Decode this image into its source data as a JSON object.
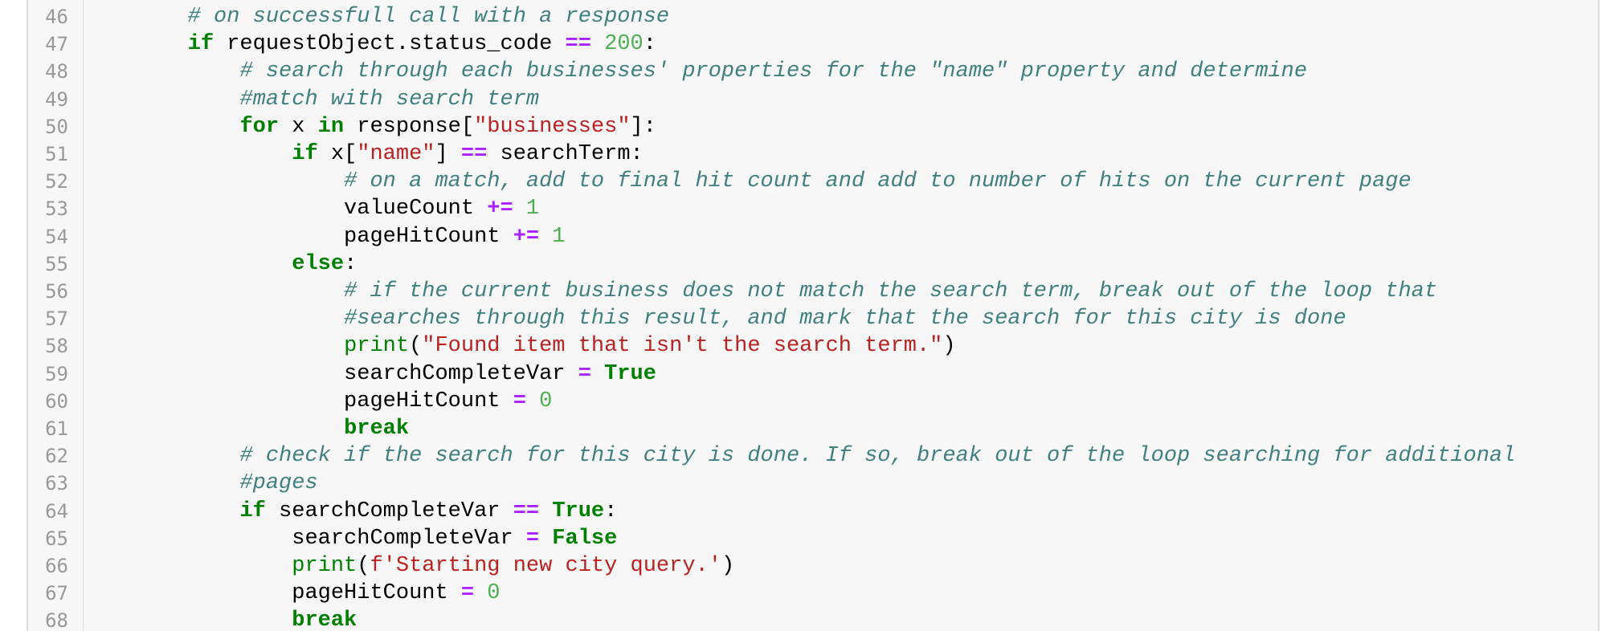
{
  "editor": {
    "colors": {
      "comment": "#408080",
      "keyword": "#008000",
      "operator": "#AA22FF",
      "number": "#4CAF50",
      "string": "#BA2121",
      "builtin": "#008000",
      "line_number": "#999999",
      "background": "#F7F7F7"
    },
    "lines": [
      {
        "n": "46",
        "tokens": [
          {
            "k": "plain",
            "t": "        "
          },
          {
            "k": "comment",
            "t": "# on successfull call with a response"
          }
        ]
      },
      {
        "n": "47",
        "tokens": [
          {
            "k": "plain",
            "t": "        "
          },
          {
            "k": "keyword",
            "t": "if"
          },
          {
            "k": "plain",
            "t": " requestObject.status_code "
          },
          {
            "k": "op",
            "t": "=="
          },
          {
            "k": "plain",
            "t": " "
          },
          {
            "k": "num",
            "t": "200"
          },
          {
            "k": "plain",
            "t": ":"
          }
        ]
      },
      {
        "n": "48",
        "tokens": [
          {
            "k": "plain",
            "t": "            "
          },
          {
            "k": "comment",
            "t": "# search through each businesses' properties for the \"name\" property and determine"
          }
        ]
      },
      {
        "n": "49",
        "tokens": [
          {
            "k": "plain",
            "t": "            "
          },
          {
            "k": "comment",
            "t": "#match with search term"
          }
        ]
      },
      {
        "n": "50",
        "tokens": [
          {
            "k": "plain",
            "t": "            "
          },
          {
            "k": "keyword",
            "t": "for"
          },
          {
            "k": "plain",
            "t": " x "
          },
          {
            "k": "keyword",
            "t": "in"
          },
          {
            "k": "plain",
            "t": " response["
          },
          {
            "k": "string",
            "t": "\"businesses\""
          },
          {
            "k": "plain",
            "t": "]:"
          }
        ]
      },
      {
        "n": "51",
        "tokens": [
          {
            "k": "plain",
            "t": "                "
          },
          {
            "k": "keyword",
            "t": "if"
          },
          {
            "k": "plain",
            "t": " x["
          },
          {
            "k": "string",
            "t": "\"name\""
          },
          {
            "k": "plain",
            "t": "] "
          },
          {
            "k": "op",
            "t": "=="
          },
          {
            "k": "plain",
            "t": " searchTerm:"
          }
        ]
      },
      {
        "n": "52",
        "tokens": [
          {
            "k": "plain",
            "t": "                    "
          },
          {
            "k": "comment",
            "t": "# on a match, add to final hit count and add to number of hits on the current page"
          }
        ]
      },
      {
        "n": "53",
        "tokens": [
          {
            "k": "plain",
            "t": "                    valueCount "
          },
          {
            "k": "op",
            "t": "+="
          },
          {
            "k": "plain",
            "t": " "
          },
          {
            "k": "num",
            "t": "1"
          }
        ]
      },
      {
        "n": "54",
        "tokens": [
          {
            "k": "plain",
            "t": "                    pageHitCount "
          },
          {
            "k": "op",
            "t": "+="
          },
          {
            "k": "plain",
            "t": " "
          },
          {
            "k": "num",
            "t": "1"
          }
        ]
      },
      {
        "n": "55",
        "tokens": [
          {
            "k": "plain",
            "t": "                "
          },
          {
            "k": "keyword",
            "t": "else"
          },
          {
            "k": "plain",
            "t": ":"
          }
        ]
      },
      {
        "n": "56",
        "tokens": [
          {
            "k": "plain",
            "t": "                    "
          },
          {
            "k": "comment",
            "t": "# if the current business does not match the search term, break out of the loop that"
          }
        ]
      },
      {
        "n": "57",
        "tokens": [
          {
            "k": "plain",
            "t": "                    "
          },
          {
            "k": "comment",
            "t": "#searches through this result, and mark that the search for this city is done"
          }
        ]
      },
      {
        "n": "58",
        "tokens": [
          {
            "k": "plain",
            "t": "                    "
          },
          {
            "k": "builtin",
            "t": "print"
          },
          {
            "k": "plain",
            "t": "("
          },
          {
            "k": "string",
            "t": "\"Found item that isn't the search term.\""
          },
          {
            "k": "plain",
            "t": ")"
          }
        ]
      },
      {
        "n": "59",
        "tokens": [
          {
            "k": "plain",
            "t": "                    searchCompleteVar "
          },
          {
            "k": "op",
            "t": "="
          },
          {
            "k": "plain",
            "t": " "
          },
          {
            "k": "keyword",
            "t": "True"
          }
        ]
      },
      {
        "n": "60",
        "tokens": [
          {
            "k": "plain",
            "t": "                    pageHitCount "
          },
          {
            "k": "op",
            "t": "="
          },
          {
            "k": "plain",
            "t": " "
          },
          {
            "k": "num",
            "t": "0"
          }
        ]
      },
      {
        "n": "61",
        "tokens": [
          {
            "k": "plain",
            "t": "                    "
          },
          {
            "k": "keyword",
            "t": "break"
          }
        ]
      },
      {
        "n": "62",
        "tokens": [
          {
            "k": "plain",
            "t": "            "
          },
          {
            "k": "comment",
            "t": "# check if the search for this city is done. If so, break out of the loop searching for additional"
          }
        ]
      },
      {
        "n": "63",
        "tokens": [
          {
            "k": "plain",
            "t": "            "
          },
          {
            "k": "comment",
            "t": "#pages"
          }
        ]
      },
      {
        "n": "64",
        "tokens": [
          {
            "k": "plain",
            "t": "            "
          },
          {
            "k": "keyword",
            "t": "if"
          },
          {
            "k": "plain",
            "t": " searchCompleteVar "
          },
          {
            "k": "op",
            "t": "=="
          },
          {
            "k": "plain",
            "t": " "
          },
          {
            "k": "keyword",
            "t": "True"
          },
          {
            "k": "plain",
            "t": ":"
          }
        ]
      },
      {
        "n": "65",
        "tokens": [
          {
            "k": "plain",
            "t": "                searchCompleteVar "
          },
          {
            "k": "op",
            "t": "="
          },
          {
            "k": "plain",
            "t": " "
          },
          {
            "k": "keyword",
            "t": "False"
          }
        ]
      },
      {
        "n": "66",
        "tokens": [
          {
            "k": "plain",
            "t": "                "
          },
          {
            "k": "builtin",
            "t": "print"
          },
          {
            "k": "plain",
            "t": "("
          },
          {
            "k": "string",
            "t": "f'Starting new city query.'"
          },
          {
            "k": "plain",
            "t": ")"
          }
        ]
      },
      {
        "n": "67",
        "tokens": [
          {
            "k": "plain",
            "t": "                pageHitCount "
          },
          {
            "k": "op",
            "t": "="
          },
          {
            "k": "plain",
            "t": " "
          },
          {
            "k": "num",
            "t": "0"
          }
        ]
      },
      {
        "n": "68",
        "tokens": [
          {
            "k": "plain",
            "t": "                "
          },
          {
            "k": "keyword",
            "t": "break"
          }
        ]
      }
    ]
  }
}
